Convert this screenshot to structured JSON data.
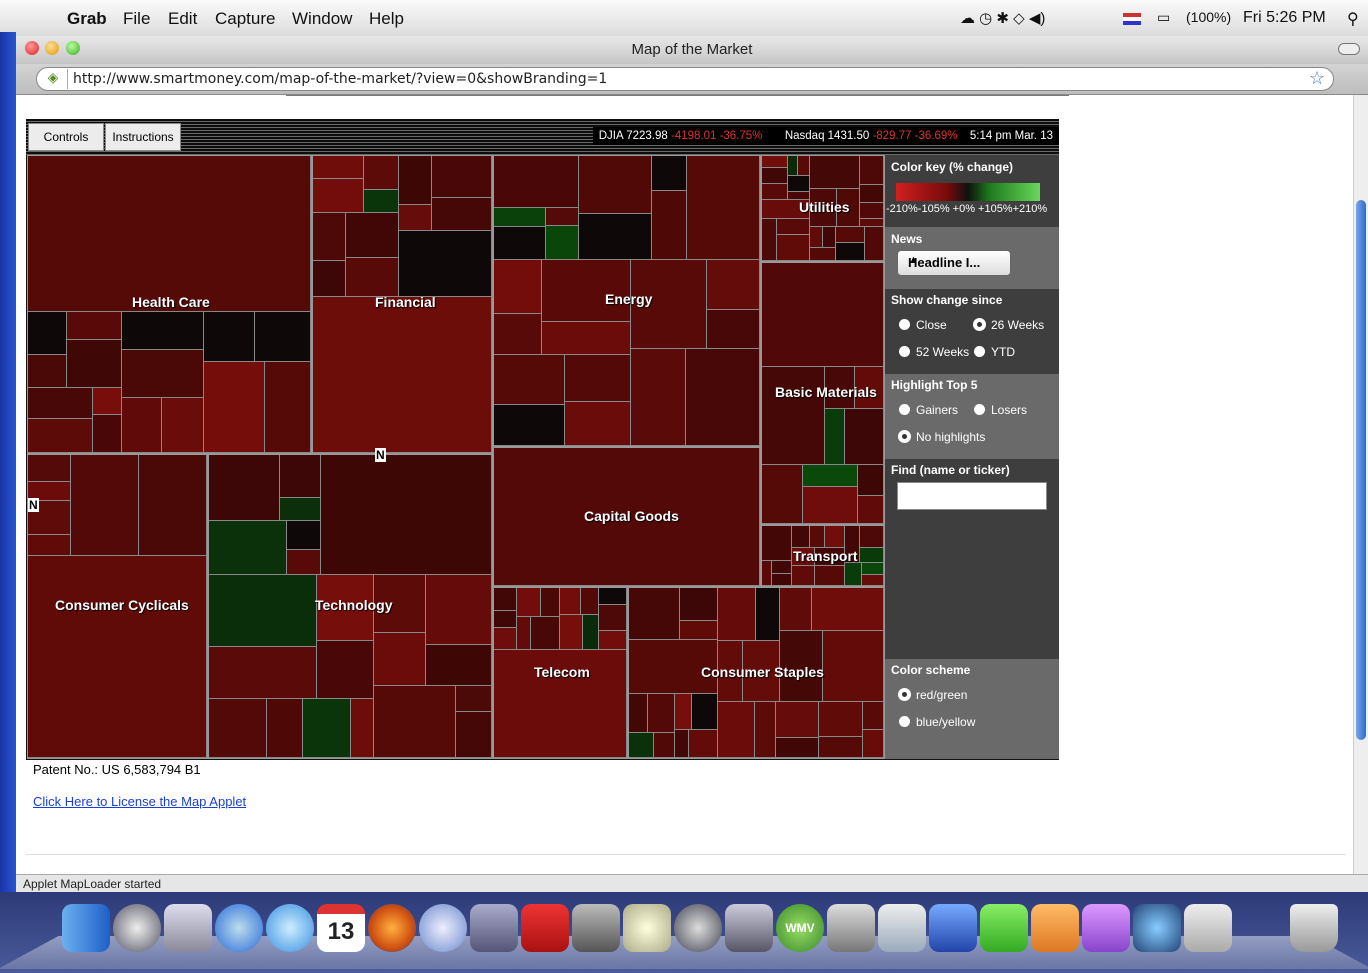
{
  "menubar": {
    "app": "Grab",
    "items": [
      "File",
      "Edit",
      "Capture",
      "Window",
      "Help"
    ],
    "battery": "(100%)",
    "clock": "Fri 5:26 PM"
  },
  "window": {
    "title": "Map of the Market",
    "url": "http://www.smartmoney.com/map-of-the-market/?view=0&showBranding=1",
    "status": "Applet MapLoader started"
  },
  "applet": {
    "controls_label": "Controls",
    "instructions_label": "Instructions",
    "ticker": {
      "djia_label": "DJIA 7223.98",
      "djia_change": "-4198.01 -36.75%",
      "nasdaq_label": "Nasdaq 1431.50",
      "nasdaq_change": "-829.77 -36.69%",
      "time": "5:14 pm  Mar. 13"
    },
    "sectors": [
      "Health Care",
      "Financial",
      "Energy",
      "Utilities",
      "Basic Materials",
      "Capital Goods",
      "Transport",
      "Consumer Cyclicals",
      "Technology",
      "Telecom",
      "Consumer Staples"
    ],
    "marker": "N",
    "panel": {
      "color_key_title": "Color key (% change)",
      "color_key_labels": "-210%-105% +0% +105%+210%",
      "news_title": "News",
      "news_value": "Headline I...",
      "show_change_title": "Show change since",
      "show_change_options": [
        "Close",
        "26 Weeks",
        "52 Weeks",
        "YTD"
      ],
      "show_change_selected": "26 Weeks",
      "highlight_title": "Highlight Top 5",
      "highlight_options": [
        "Gainers",
        "Losers",
        "No highlights"
      ],
      "highlight_selected": "No highlights",
      "find_title": "Find (name or ticker)",
      "scheme_title": "Color scheme",
      "scheme_options": [
        "red/green",
        "blue/yellow"
      ],
      "scheme_selected": "red/green"
    }
  },
  "below": {
    "patent": "Patent No.: US 6,583,794 B1",
    "license_link": "Click Here to License the Map Applet"
  },
  "dock": {
    "calendar_day": "13",
    "wmv_label": "WMV"
  },
  "colors": {
    "tile_dark_red": "#3a0808",
    "panel_gray": "#4a4a4a",
    "link_blue": "#1a3fd8",
    "negative_red": "#e23030"
  }
}
